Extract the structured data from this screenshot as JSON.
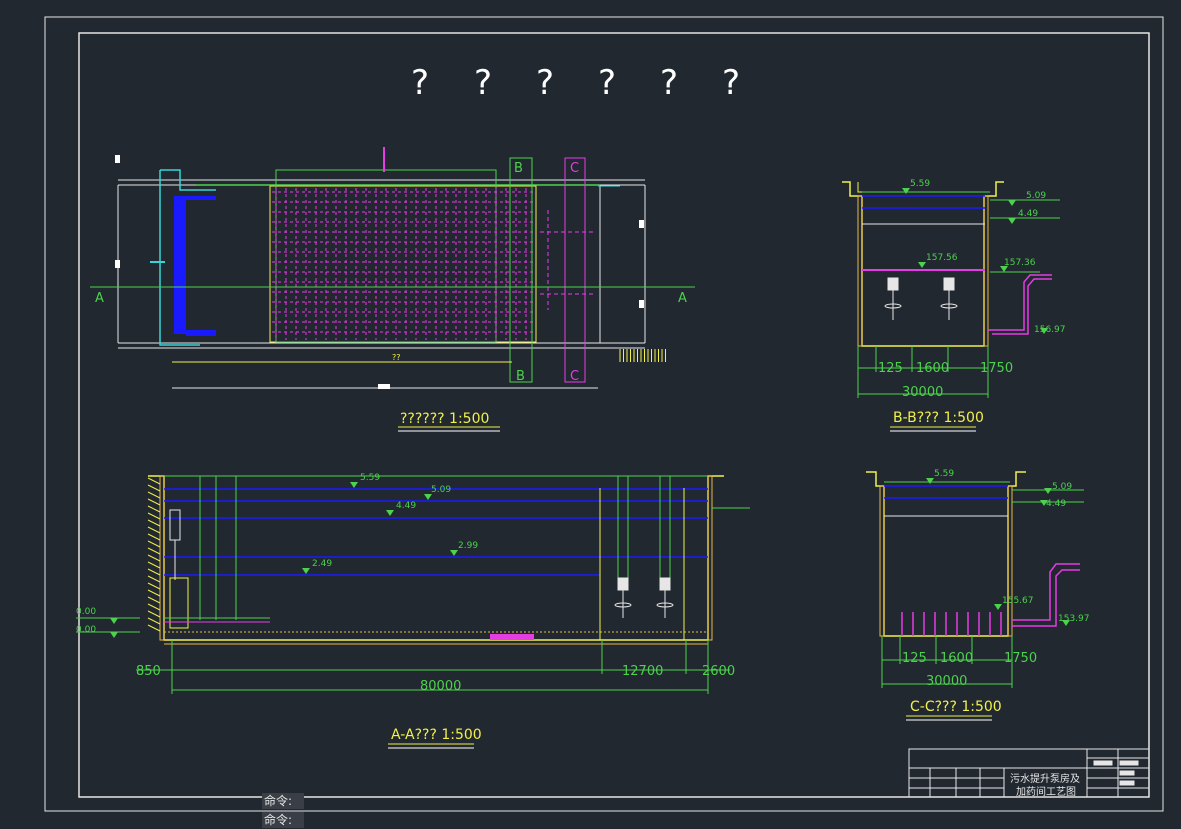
{
  "colors": {
    "background": "#212830",
    "frame": "#e6e6e6",
    "green": "#4cd24c",
    "yellow": "#f2f04a",
    "blue": "#1a1aff",
    "magenta": "#e63ce6",
    "cyan": "#35d6d6"
  },
  "drawing": {
    "title_glyphs": [
      "?",
      "?",
      "?",
      "?",
      "?",
      "?"
    ]
  },
  "plan_view": {
    "caption": "?????? 1:500",
    "section_marks": [
      "A",
      "A",
      "B",
      "B",
      "C",
      "C"
    ],
    "center_label": "??"
  },
  "section_bb": {
    "caption": "B-B??? 1:500",
    "levels": [
      "5.59",
      "5.09",
      "4.49",
      "157.56",
      "157.36",
      "156.97"
    ],
    "dimensions": [
      "125",
      "1600",
      "1750",
      "30000"
    ]
  },
  "section_cc": {
    "caption": "C-C??? 1:500",
    "levels": [
      "5.59",
      "5.09",
      "4.49",
      "155.67",
      "153.97"
    ],
    "dimensions": [
      "125",
      "1600",
      "1750",
      "30000"
    ]
  },
  "section_aa": {
    "caption": "A-A??? 1:500",
    "levels": [
      "5.59",
      "5.09",
      "4.49",
      "2.99",
      "2.49",
      "0.00",
      "0.00"
    ],
    "dimensions": [
      "850",
      "80000",
      "12700",
      "2600"
    ]
  },
  "title_block": {
    "project_title_line1": "污水提升泵房及",
    "project_title_line2": "加药间工艺图"
  },
  "command_line": {
    "prompt1": "命令:",
    "prompt2": "命令:"
  }
}
